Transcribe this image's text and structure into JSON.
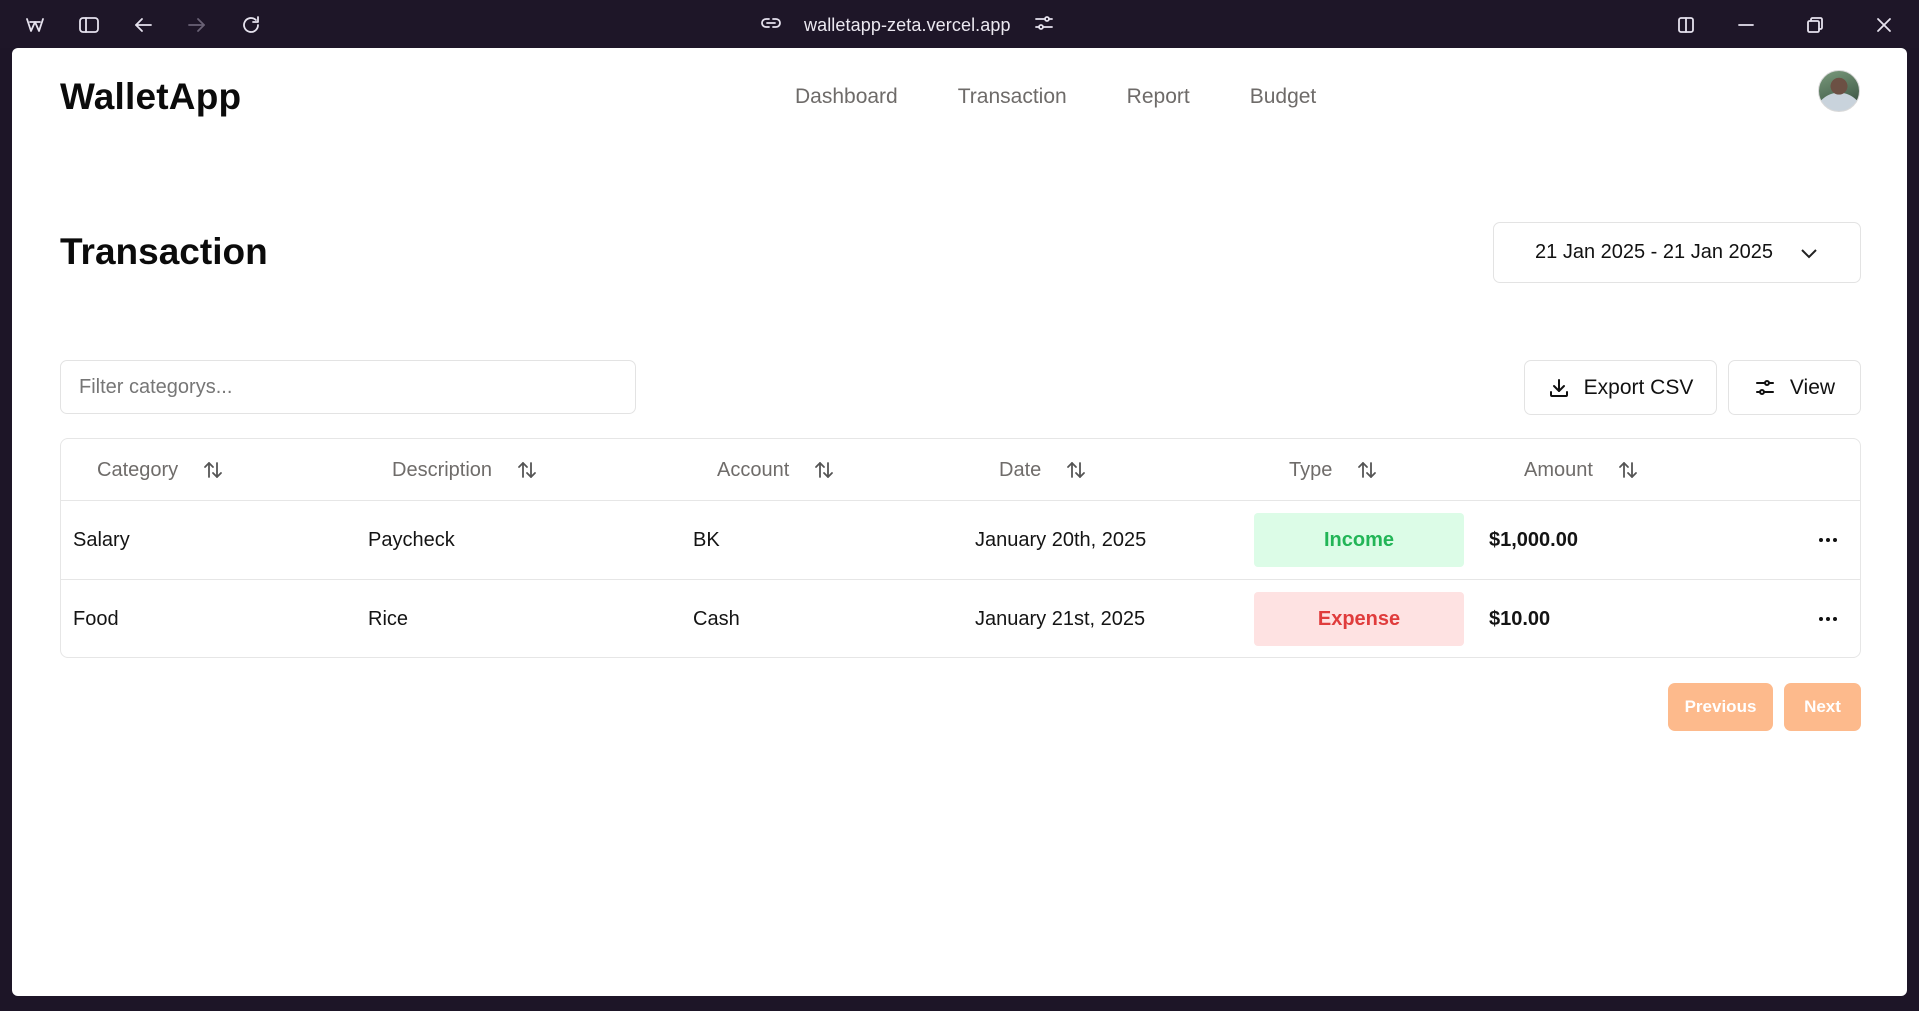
{
  "browser": {
    "url": "walletapp-zeta.vercel.app",
    "icons": [
      "workspace-icon",
      "sidebar-toggle-icon",
      "back-icon",
      "forward-icon",
      "reload-icon",
      "link-icon",
      "site-settings-icon",
      "split-view-icon",
      "minimize-icon",
      "restore-icon",
      "close-icon"
    ]
  },
  "header": {
    "brand": "WalletApp",
    "nav": [
      "Dashboard",
      "Transaction",
      "Report",
      "Budget"
    ]
  },
  "page": {
    "title": "Transaction",
    "date_range": "21 Jan 2025 - 21 Jan 2025"
  },
  "toolbar": {
    "filter_placeholder": "Filter categorys...",
    "export_label": "Export CSV",
    "view_label": "View"
  },
  "table": {
    "columns": [
      "Category",
      "Description",
      "Account",
      "Date",
      "Type",
      "Amount"
    ],
    "rows": [
      {
        "category": "Salary",
        "description": "Paycheck",
        "account": "BK",
        "date": "January 20th, 2025",
        "type": "Income",
        "amount": "$1,000.00"
      },
      {
        "category": "Food",
        "description": "Rice",
        "account": "Cash",
        "date": "January 21st, 2025",
        "type": "Expense",
        "amount": "$10.00"
      }
    ]
  },
  "pagination": {
    "previous": "Previous",
    "next": "Next"
  },
  "colors": {
    "income_bg": "#dcfce7",
    "income_text": "#22b557",
    "expense_bg": "#fee2e2",
    "expense_text": "#e03c3c",
    "pager_disabled": "#fdba8c",
    "chrome_bg": "#1e1628"
  }
}
